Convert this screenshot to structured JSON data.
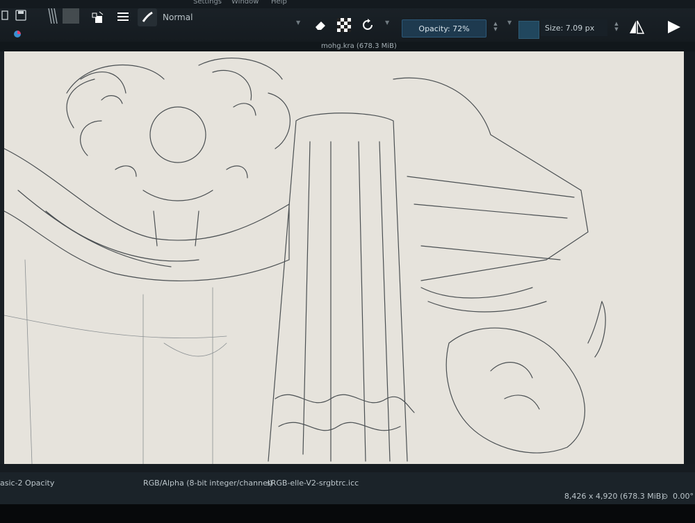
{
  "menu": {
    "items": [
      "Settings",
      "Window",
      "Help"
    ]
  },
  "toolbar": {
    "blend_mode": "Normal",
    "opacity_label": "Opacity: 72%",
    "size_label": "Size: 7.09 px",
    "swatch_color": "#21475e",
    "icons": [
      "new-document-icon",
      "save-icon",
      "gradient-icon",
      "pattern-icon",
      "swap-colors-icon",
      "preset-list-icon",
      "brush-preset-icon",
      "eraser-icon",
      "alpha-lock-icon",
      "reload-preset-icon",
      "mirror-horizontal-icon",
      "mirror-vertical-icon"
    ]
  },
  "window": {
    "title": "mohg.kra (678.3 MiB)"
  },
  "status": {
    "brush_preset": "asic-2 Opacity",
    "color_model": "RGB/Alpha (8-bit integer/channel)",
    "color_profile": "sRGB-elle-V2-srgbtrc.icc",
    "image_size": "8,426 x 4,920 (678.3 MiB)",
    "rotation": "0.00°"
  }
}
